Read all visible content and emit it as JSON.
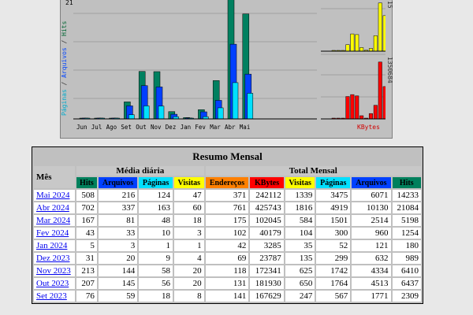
{
  "graph": {
    "y_label_parts": [
      "Páginas",
      " / ",
      "Arquivos",
      " / ",
      "Hits"
    ],
    "top_tick_left": "21",
    "right_tick_top": "15",
    "right_tick_mid": "1350684",
    "kbytes_label": "KBytes",
    "months": [
      "Jun",
      "Jul",
      "Ago",
      "Set",
      "Out",
      "Nov",
      "Dez",
      "Jan",
      "Fev",
      "Mar",
      "Abr",
      "Mai"
    ],
    "colors": {
      "hits": "#008060",
      "arquivos": "#0040ff",
      "paginas": "#00e0ff",
      "visitas": "#ffff00",
      "kbytes": "#ff0000",
      "grid": "#a0a0a0"
    }
  },
  "table": {
    "title": "Resumo Mensal",
    "mes_header": "Mês",
    "group_daily": "Média diária",
    "group_total": "Total Mensal",
    "daily_headers": [
      "Hits",
      "Arquivos",
      "Páginas",
      "Visitas"
    ],
    "total_headers": [
      "Endereços",
      "KBytes",
      "Visitas",
      "Páginas",
      "Arquivos",
      "Hits"
    ],
    "rows": [
      {
        "month": "Mai 2024",
        "d": [
          "508",
          "216",
          "124",
          "47"
        ],
        "t": [
          "371",
          "242112",
          "1339",
          "3475",
          "6071",
          "14233"
        ]
      },
      {
        "month": "Abr 2024",
        "d": [
          "702",
          "337",
          "163",
          "60"
        ],
        "t": [
          "761",
          "425743",
          "1816",
          "4919",
          "10130",
          "21084"
        ]
      },
      {
        "month": "Mar 2024",
        "d": [
          "167",
          "81",
          "48",
          "18"
        ],
        "t": [
          "175",
          "102045",
          "584",
          "1501",
          "2514",
          "5198"
        ]
      },
      {
        "month": "Fev 2024",
        "d": [
          "43",
          "33",
          "10",
          "3"
        ],
        "t": [
          "102",
          "40179",
          "104",
          "300",
          "960",
          "1254"
        ]
      },
      {
        "month": "Jan 2024",
        "d": [
          "5",
          "3",
          "1",
          "1"
        ],
        "t": [
          "42",
          "3285",
          "35",
          "52",
          "121",
          "180"
        ]
      },
      {
        "month": "Dez 2023",
        "d": [
          "31",
          "20",
          "9",
          "4"
        ],
        "t": [
          "69",
          "23787",
          "135",
          "299",
          "632",
          "989"
        ]
      },
      {
        "month": "Nov 2023",
        "d": [
          "213",
          "144",
          "58",
          "20"
        ],
        "t": [
          "118",
          "172341",
          "625",
          "1742",
          "4334",
          "6410"
        ]
      },
      {
        "month": "Out 2023",
        "d": [
          "207",
          "145",
          "56",
          "20"
        ],
        "t": [
          "131",
          "181930",
          "650",
          "1764",
          "4513",
          "6437"
        ]
      },
      {
        "month": "Set 2023",
        "d": [
          "76",
          "59",
          "18",
          "8"
        ],
        "t": [
          "141",
          "167629",
          "247",
          "567",
          "1771",
          "2309"
        ]
      }
    ]
  },
  "chart_data": {
    "type": "bar",
    "categories": [
      "Jun",
      "Jul",
      "Ago",
      "Set",
      "Out",
      "Nov",
      "Dez",
      "Jan",
      "Fev",
      "Mar",
      "Abr",
      "Mai"
    ],
    "series": [
      {
        "name": "Hits",
        "values": [
          0,
          0,
          0,
          2309,
          6437,
          6410,
          989,
          180,
          1254,
          5198,
          21084,
          14233
        ]
      },
      {
        "name": "Arquivos",
        "values": [
          0,
          0,
          0,
          1771,
          4513,
          4334,
          632,
          121,
          960,
          2514,
          10130,
          6071
        ]
      },
      {
        "name": "Páginas",
        "values": [
          0,
          0,
          0,
          567,
          1764,
          1742,
          299,
          52,
          300,
          1501,
          4919,
          3475
        ]
      },
      {
        "name": "Visitas",
        "values": [
          0,
          0,
          0,
          247,
          650,
          625,
          135,
          35,
          104,
          584,
          1816,
          1339
        ]
      },
      {
        "name": "KBytes",
        "values": [
          0,
          0,
          0,
          167629,
          181930,
          172341,
          23787,
          3285,
          40179,
          102045,
          425743,
          242112
        ]
      }
    ]
  }
}
